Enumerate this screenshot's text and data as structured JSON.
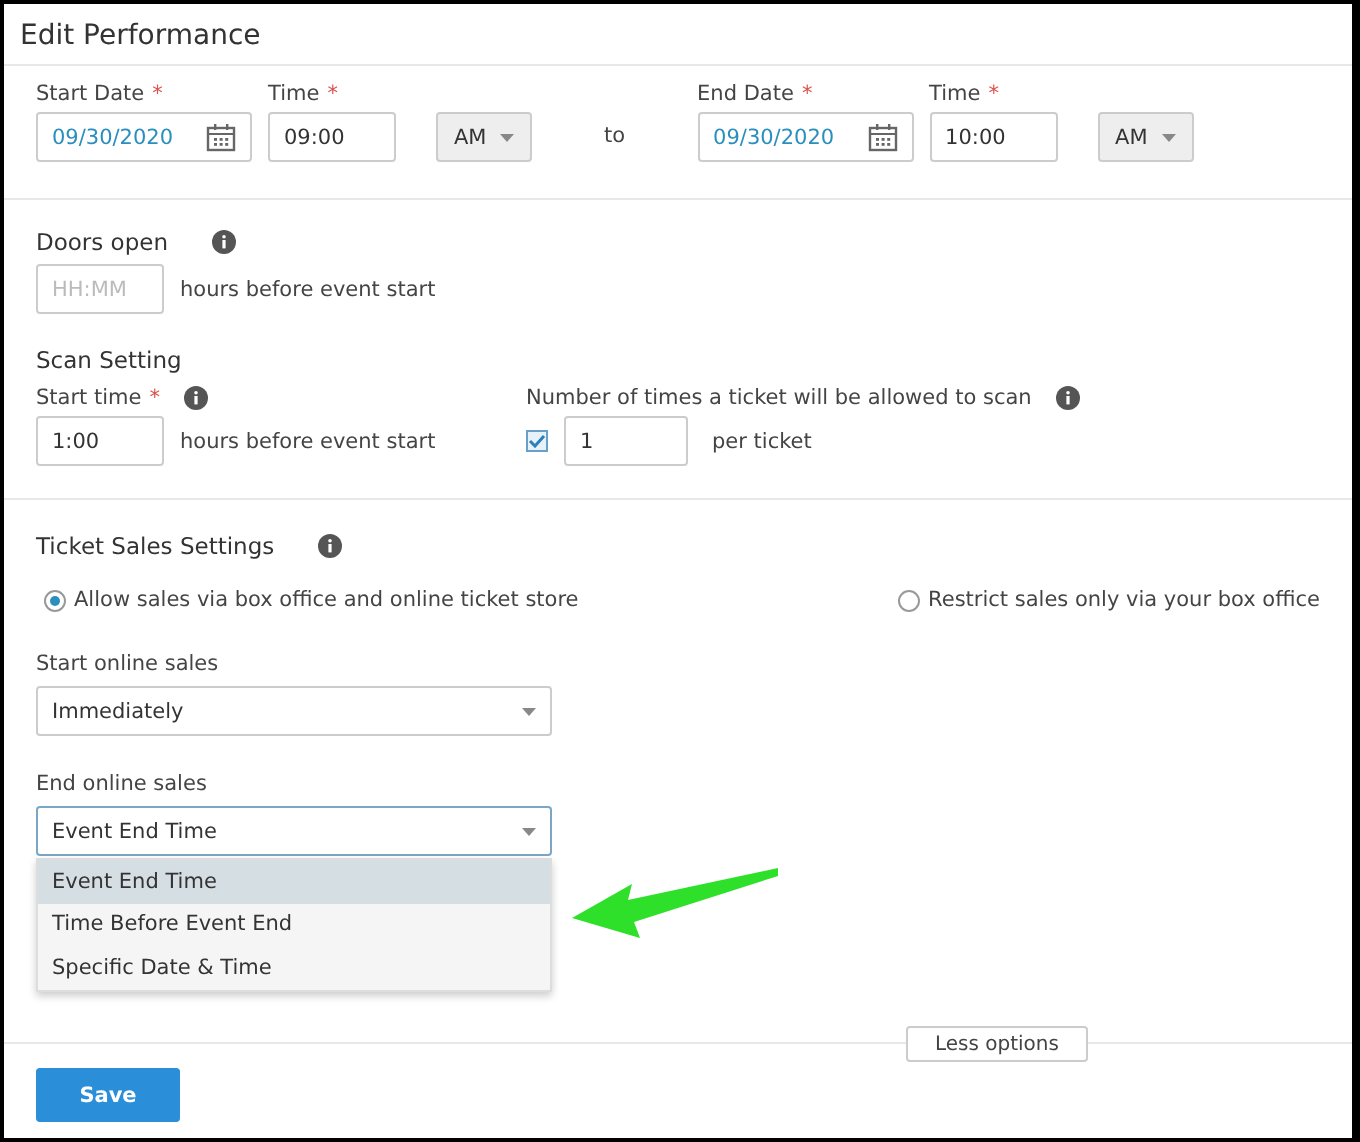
{
  "window": {
    "title": "Edit Performance"
  },
  "schedule": {
    "start_date": {
      "label": "Start Date",
      "required_mark": "*",
      "value": "09/30/2020"
    },
    "start_time": {
      "label": "Time",
      "required_mark": "*",
      "value": "09:00"
    },
    "start_period": "AM",
    "separator": "to",
    "end_date": {
      "label": "End Date",
      "required_mark": "*",
      "value": "09/30/2020"
    },
    "end_time": {
      "label": "Time",
      "required_mark": "*",
      "value": "10:00"
    },
    "end_period": "AM"
  },
  "doors_open": {
    "title": "Doors open",
    "placeholder": "HH:MM",
    "suffix": "hours before event start"
  },
  "scan_setting": {
    "title": "Scan Setting",
    "start_time": {
      "label": "Start time",
      "required_mark": "*",
      "value": "1:00",
      "suffix": "hours before event start"
    },
    "scan_limit": {
      "label": "Number of times a ticket will be allowed to scan",
      "checked": true,
      "value": "1",
      "suffix": "per ticket"
    }
  },
  "ticket_sales": {
    "title": "Ticket Sales Settings",
    "options": [
      {
        "label": "Allow sales via box office and online ticket store",
        "selected": true
      },
      {
        "label": "Restrict sales only via your box office",
        "selected": false
      }
    ],
    "start_online_sales": {
      "label": "Start online sales",
      "value": "Immediately"
    },
    "end_online_sales": {
      "label": "End online sales",
      "value": "Event End Time",
      "expanded": true,
      "options": [
        {
          "label": "Event End Time",
          "selected": true
        },
        {
          "label": "Time Before Event End",
          "selected": false
        },
        {
          "label": "Specific Date & Time",
          "selected": false
        }
      ]
    }
  },
  "less_options": "Less options",
  "buttons": [
    "Save"
  ]
}
